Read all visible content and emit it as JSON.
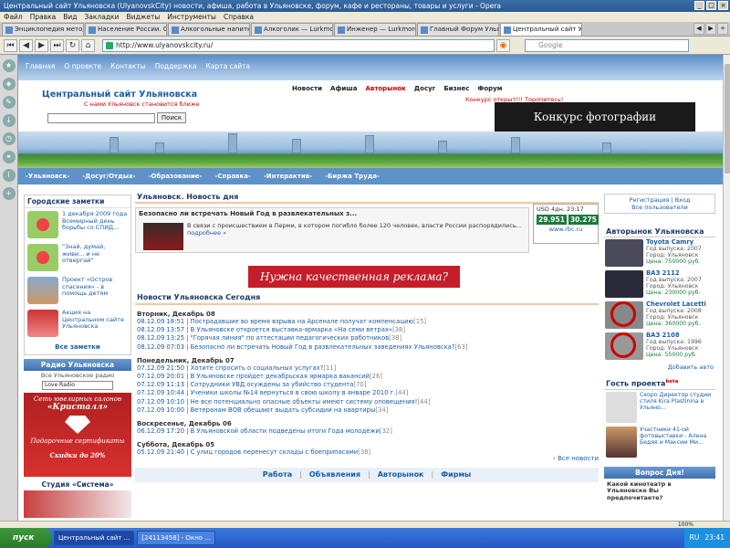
{
  "window": {
    "title": "Центральный сайт Ульяновска (UlyanovskCity) новости, афиша, работа в Ульяновске, форум, кафе и рестораны, товары и услуги - Opera"
  },
  "menubar": [
    "Файл",
    "Правка",
    "Вид",
    "Закладки",
    "Виджеты",
    "Инструменты",
    "Справка"
  ],
  "tabs": [
    {
      "label": "Энциклопедия методи..."
    },
    {
      "label": "Население России. Ст..."
    },
    {
      "label": "Алкогольные напитки..."
    },
    {
      "label": "Алкоголик — Lurkmore"
    },
    {
      "label": "Инженер — Lurkmore"
    },
    {
      "label": "Главный Форум Ульян..."
    },
    {
      "label": "Центральный сайт Ул...",
      "active": true
    }
  ],
  "address": {
    "url": "http://www.ulyanovskcity.ru/",
    "search_placeholder": "Google"
  },
  "site": {
    "topnav": [
      "Главная",
      "О проекте",
      "Контакты",
      "Поддержка",
      "Карта сайта"
    ],
    "logo": "Центральный сайт Ульяновска",
    "slogan": "С нами Ульяновск становится ближе",
    "search_button": "Поиск",
    "mainmenu": [
      {
        "label": "Новости"
      },
      {
        "label": "Афиша"
      },
      {
        "label": "Авторынок",
        "hl": true
      },
      {
        "label": "Досуг"
      },
      {
        "label": "Бизнес"
      },
      {
        "label": "Форум",
        "hl": false
      }
    ],
    "contest_notice": "Конкурс открыт!!! Торопитесь!",
    "photo_banner": "Конкурс фотографии",
    "categories": [
      "-Ульяновск-",
      "-Досуг/Отдых-",
      "-Образование-",
      "-Справка-",
      "-Интерактив-",
      "-Биржа Труда-"
    ]
  },
  "left": {
    "notes_title": "Городские заметки",
    "notes": [
      {
        "text": "1 декабря 2009 года Всемирный день борьбы со СПИД..."
      },
      {
        "text": "\"Знай, думай, живи... и не отвергай\""
      },
      {
        "text": "Проект «Остров спасения» - в помощь детям"
      },
      {
        "text": "Акция на Центральном сайте Ульяновска"
      }
    ],
    "all_notes": "Все заметки",
    "radio_title": "Радио Ульяновска",
    "radio_text": "Все Ульяновское радио",
    "radio_select": "Love Radio",
    "jewel": {
      "line1": "Сеть ювелирных салонов",
      "brand": "«Кристалл»",
      "line2": "Подарочные сертификаты",
      "line3": "Скидки до 20%"
    },
    "studio_title": "Студия «Система»"
  },
  "center": {
    "day_title": "Ульяновск. Новость дня",
    "featured": {
      "title": "Безопасно ли встречать Новый Год в развлекательных з...",
      "desc": "В связи с происшествием в Перми, в котором погибло более 120 человек, власти России распорядились...",
      "more": "подробнее »"
    },
    "usd": {
      "label": "USD 4дн. 23:17",
      "v1": "29.951",
      "v2": "30.275",
      "src": "www.rbc.ru"
    },
    "ad": "Нужна качественная реклама?",
    "today_title": "Новости Ульяновска Сегодня",
    "days": [
      {
        "day": "Вторник, Декабрь 08",
        "items": [
          {
            "t": "08.12.09 18:51 | Пострадавшие во время взрыва на Арсенале получат компенсацию",
            "c": "[15]"
          },
          {
            "t": "08.12.09 13:57 | В Ульяновске откроется выставка-ярмарка «На семи ветрах»",
            "c": "[38]"
          },
          {
            "t": "08.12.09 13:25 | \"Горячая линия\" по аттестации педагогических работников",
            "c": "[38]"
          },
          {
            "t": "08.12.09 07:03 | Безопасно ли встречать Новый Год в развлекательных заведениях Ульяновска?",
            "c": "[63]"
          }
        ]
      },
      {
        "day": "Понедельник, Декабрь 07",
        "items": [
          {
            "t": "07.12.09 21:50 | Хотите спросить о социальных услугах?",
            "c": "[11]"
          },
          {
            "t": "07.12.09 20:01 | В Ульяновске пройдет декабрьская ярмарка вакансий",
            "c": "[26]"
          },
          {
            "t": "07.12.09 11:13 | Сотрудники УВД осуждены за убийство студента",
            "c": "[70]"
          },
          {
            "t": "07.12.09 10:44 | Ученики школы №14 вернуться в свою школу в январе 2010 г.",
            "c": "[44]"
          },
          {
            "t": "07.12.09 10:10 | Не все потенциально опасные объекты имеют систему оповещения!",
            "c": "[44]"
          },
          {
            "t": "07.12.09 10:00 | Ветеранам ВОВ обещают выдать субсидии на квартиры",
            "c": "[34]"
          }
        ]
      },
      {
        "day": "Воскресенье, Декабрь 06",
        "items": [
          {
            "t": "06.12.09 17:20 | В Ульяновской области подведены итоги Года молодёжи",
            "c": "[32]"
          }
        ]
      },
      {
        "day": "Суббота, Декабрь 05",
        "items": [
          {
            "t": "05.12.09 21:40 | С улиц городов перенесут склады с боеприпасами",
            "c": "[38]"
          }
        ]
      }
    ],
    "all_news": "› Все новости",
    "bottom_links": [
      "Работа",
      "Объявления",
      "Авторынок",
      "Фирмы"
    ]
  },
  "right": {
    "reg1": "Регистрация | Вход",
    "reg2": "Все пользователи",
    "auto_title": "Авторынок Ульяновска",
    "cars": [
      {
        "name": "Toyota Camry",
        "year": "Год выпуска: 2007",
        "city": "Город: Ульяновск",
        "price": "Цена: 750000 руб.",
        "color": "#4a4a5a",
        "banned": false
      },
      {
        "name": "ВАЗ 2112",
        "year": "Год выпуска: 2007",
        "city": "Город: Ульяновск",
        "price": "Цена: 230000 руб.",
        "color": "#2a2a3a",
        "banned": false
      },
      {
        "name": "Chevrolet Lacetti",
        "year": "Год выпуска: 2008",
        "city": "Город: Ульяновск",
        "price": "Цена: 360000 руб.",
        "color": "#888",
        "banned": true
      },
      {
        "name": "ВАЗ 2108",
        "year": "Год выпуска: 1996",
        "city": "Город: Ульяновск",
        "price": "Цена: 55000 руб.",
        "color": "#999",
        "banned": true
      }
    ],
    "add_all": "Добавить авто",
    "guest_title": "Гость проекта",
    "guest_sup": "beta",
    "guests": [
      {
        "text": "Скоро Директор студии стиля Kira Plastinina в Ульяно..."
      },
      {
        "text": "Участники 41-ой фотовыставки - Алена Бедяя и Максим Ми..."
      }
    ],
    "question_title": "Вопрос Дня!",
    "question_text": "Какой кинотеатр в Ульяновске Вы предпочитаете?"
  },
  "status": {
    "zoom": "100%"
  },
  "taskbar": {
    "start": "пуск",
    "items": [
      {
        "label": "Центральный сайт ...",
        "active": true
      },
      {
        "label": "[24113458] - Окно ..."
      }
    ],
    "lang": "RU",
    "time": "23:41"
  }
}
